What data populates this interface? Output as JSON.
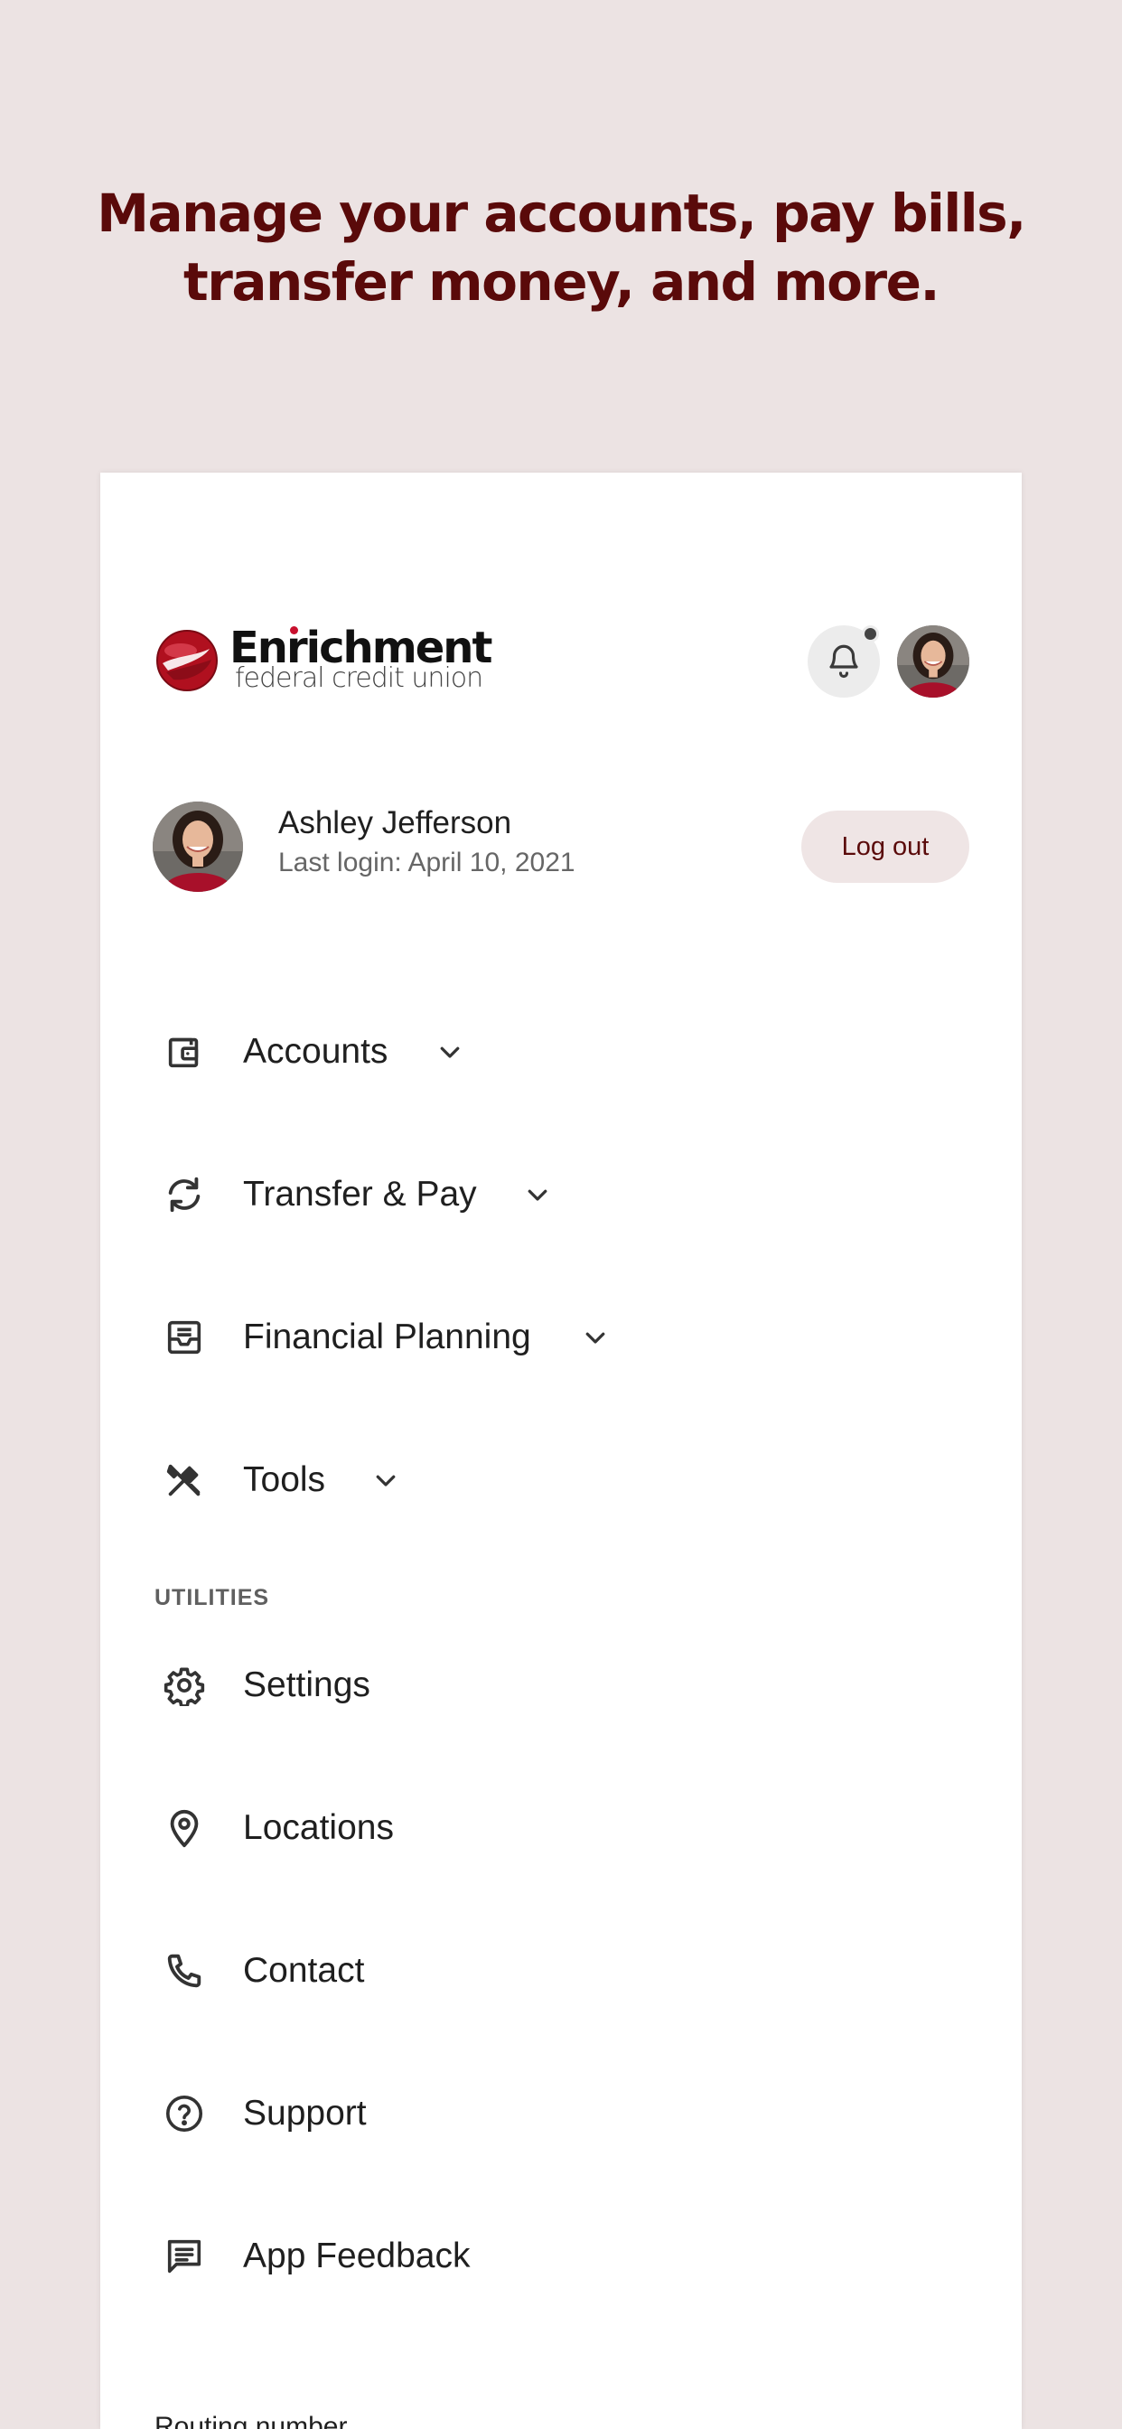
{
  "hero": {
    "line1": "Manage your accounts, pay bills,",
    "line2": "transfer money, and more."
  },
  "brand": {
    "name": "Enrichment",
    "subtitle": "federal credit union",
    "accent_color": "#c8102e",
    "hero_color": "#5a0a0a"
  },
  "header": {
    "bell_icon": "bell-icon",
    "has_notification": true
  },
  "profile": {
    "name": "Ashley Jefferson",
    "last_login": "Last login: April 10, 2021",
    "logout_label": "Log out"
  },
  "menu": {
    "primary": [
      {
        "label": "Accounts",
        "icon": "wallet-icon",
        "expandable": true
      },
      {
        "label": "Transfer & Pay",
        "icon": "sync-icon",
        "expandable": true
      },
      {
        "label": "Financial Planning",
        "icon": "inbox-icon",
        "expandable": true
      },
      {
        "label": "Tools",
        "icon": "tools-icon",
        "expandable": true
      }
    ],
    "utilities_label": "UTILITIES",
    "utilities": [
      {
        "label": "Settings",
        "icon": "gear-icon"
      },
      {
        "label": "Locations",
        "icon": "location-pin-icon"
      },
      {
        "label": "Contact",
        "icon": "phone-icon"
      },
      {
        "label": "Support",
        "icon": "help-circle-icon"
      },
      {
        "label": "App Feedback",
        "icon": "feedback-icon"
      }
    ]
  },
  "footer": {
    "routing_label": "Routing number"
  }
}
